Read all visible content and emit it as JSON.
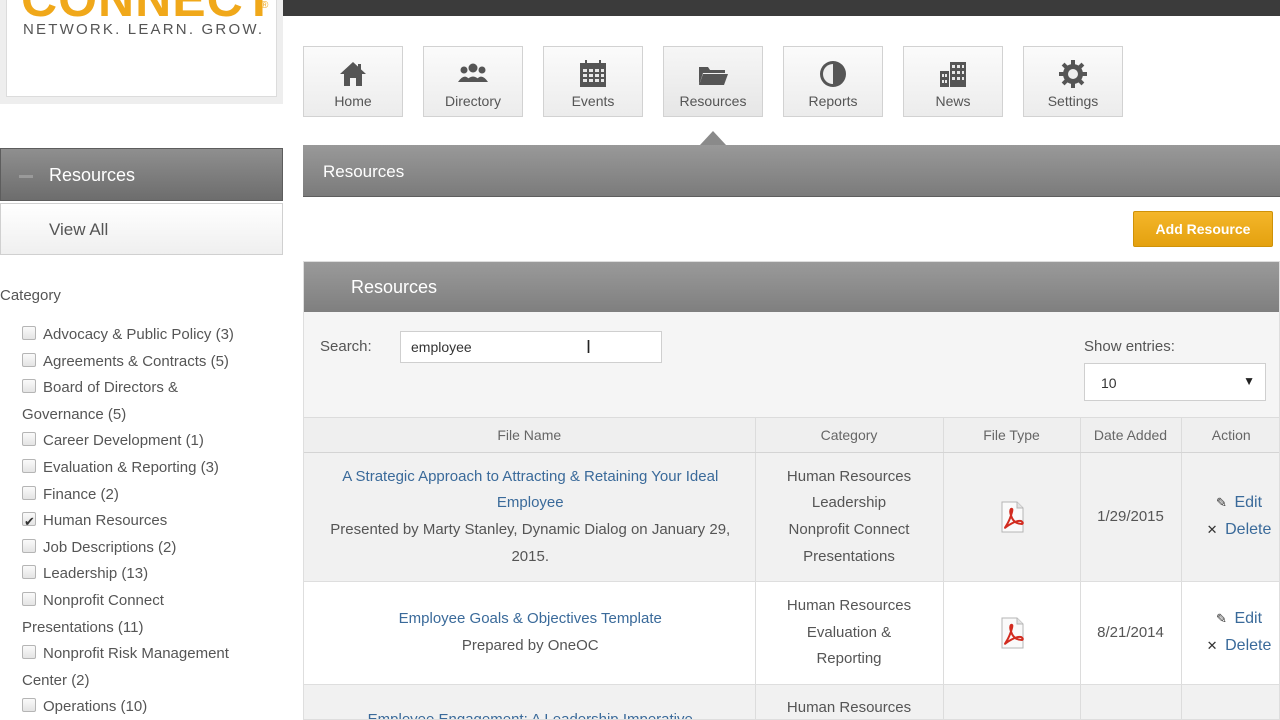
{
  "logo": {
    "word": "CONNECT",
    "registered": "®",
    "tagline": "NETWORK. LEARN. GROW."
  },
  "nav": [
    {
      "label": "Home",
      "icon": "home-icon"
    },
    {
      "label": "Directory",
      "icon": "people-icon"
    },
    {
      "label": "Events",
      "icon": "calendar-icon"
    },
    {
      "label": "Resources",
      "icon": "folder-icon",
      "active": true
    },
    {
      "label": "Reports",
      "icon": "pie-chart-icon"
    },
    {
      "label": "News",
      "icon": "building-icon"
    },
    {
      "label": "Settings",
      "icon": "gear-icon"
    }
  ],
  "sidebar": {
    "header": "Resources",
    "view_all": "View All",
    "category_title": "Category",
    "categories": [
      {
        "label": "Advocacy & Public Policy (3)",
        "checked": false
      },
      {
        "label": "Agreements & Contracts (5)",
        "checked": false
      },
      {
        "label": "Board of Directors &",
        "cont": "Governance (5)",
        "checked": false
      },
      {
        "label": "Career Development (1)",
        "checked": false
      },
      {
        "label": "Evaluation & Reporting (3)",
        "checked": false
      },
      {
        "label": "Finance (2)",
        "checked": false
      },
      {
        "label": "Human Resources",
        "checked": true
      },
      {
        "label": "Job Descriptions (2)",
        "checked": false
      },
      {
        "label": "Leadership (13)",
        "checked": false
      },
      {
        "label": "Nonprofit Connect",
        "cont": "Presentations (11)",
        "checked": false
      },
      {
        "label": "Nonprofit Risk Management",
        "cont": "Center (2)",
        "checked": false
      },
      {
        "label": "Operations (10)",
        "checked": false
      }
    ]
  },
  "main": {
    "header": "Resources",
    "add_button": "Add Resource",
    "panel_title": "Resources",
    "search_label": "Search:",
    "search_value": "employee",
    "show_label": "Show entries:",
    "show_value": "10",
    "columns": [
      "File Name",
      "Category",
      "File Type",
      "Date Added",
      "Action"
    ],
    "rows": [
      {
        "title": "A Strategic Approach to Attracting & Retaining Your Ideal Employee",
        "desc": "Presented by Marty Stanley, Dynamic Dialog on January 29, 2015.",
        "categories": [
          "Human Resources",
          "Leadership",
          "Nonprofit Connect Presentations"
        ],
        "date": "1/29/2015",
        "edit": "Edit",
        "delete": "Delete"
      },
      {
        "title": "Employee Goals & Objectives Template",
        "desc": "Prepared by OneOC",
        "categories": [
          "Human Resources",
          "Evaluation & Reporting"
        ],
        "date": "8/21/2014",
        "edit": "Edit",
        "delete": "Delete"
      },
      {
        "title": "Employee Engagement: A Leadership Imperative",
        "desc": "",
        "categories": [
          "Human Resources"
        ],
        "date": "",
        "edit": "",
        "delete": ""
      }
    ]
  },
  "colors": {
    "accent": "#f0a81a",
    "button": "#e9a916",
    "header_gray": "#808080",
    "link": "#3a6a9a"
  }
}
